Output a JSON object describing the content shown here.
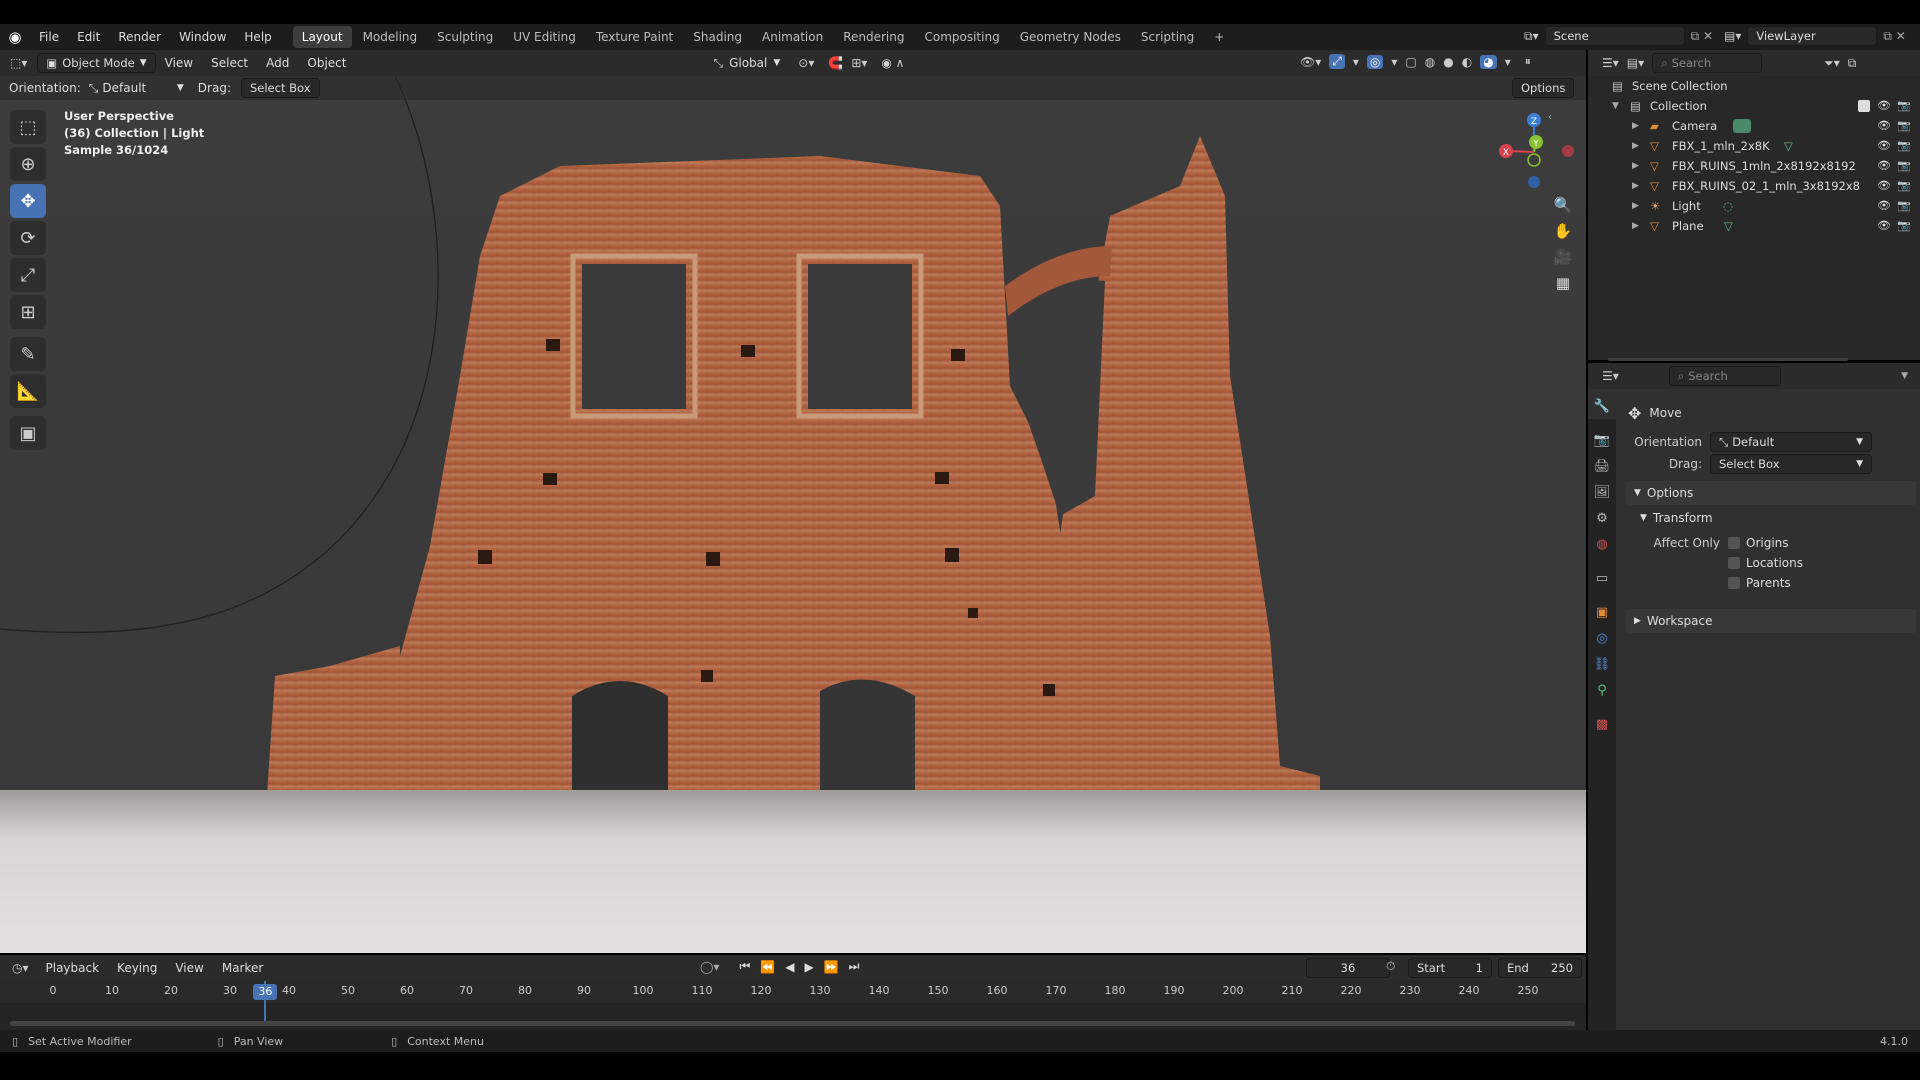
{
  "topbar": {
    "menus": [
      "File",
      "Edit",
      "Render",
      "Window",
      "Help"
    ],
    "workspaces": [
      "Layout",
      "Modeling",
      "Sculpting",
      "UV Editing",
      "Texture Paint",
      "Shading",
      "Animation",
      "Rendering",
      "Compositing",
      "Geometry Nodes",
      "Scripting"
    ],
    "add_tab": "+",
    "scene": "Scene",
    "view_layer": "ViewLayer"
  },
  "viewport_header": {
    "mode": "Object Mode",
    "menus": [
      "View",
      "Select",
      "Add",
      "Object"
    ],
    "transform_orientation": "Global"
  },
  "tool_header": {
    "orientation_label": "Orientation:",
    "orientation_value": "Default",
    "drag_label": "Drag:",
    "drag_value": "Select Box",
    "options": "Options"
  },
  "viewport": {
    "overlay_lines": [
      "User Perspective",
      "(36) Collection | Light",
      "Sample 36/1024"
    ],
    "gizmo": {
      "z": "Z",
      "y": "Y",
      "x": "X"
    }
  },
  "outliner": {
    "search_placeholder": "Search",
    "scene_collection": "Scene Collection",
    "collection": "Collection",
    "items": [
      {
        "name": "Camera",
        "icon": "camera-icon",
        "color": "#c07840"
      },
      {
        "name": "FBX_1_mln_2x8K",
        "icon": "mesh-icon",
        "color": "#e08a3c"
      },
      {
        "name": "FBX_RUINS_1mln_2x8192x8192",
        "icon": "mesh-icon",
        "color": "#e08a3c"
      },
      {
        "name": "FBX_RUINS_02_1_mln_3x8192x8",
        "icon": "mesh-icon",
        "color": "#e08a3c"
      },
      {
        "name": "Light",
        "icon": "light-icon",
        "color": "#c07840"
      },
      {
        "name": "Plane",
        "icon": "mesh-icon",
        "color": "#e08a3c"
      }
    ]
  },
  "properties": {
    "search_placeholder": "Search",
    "tool_name": "Move",
    "orientation_label": "Orientation",
    "orientation_value": "Default",
    "drag_label": "Drag:",
    "drag_value": "Select Box",
    "options_panel": "Options",
    "transform_panel": "Transform",
    "affect_only_label": "Affect Only",
    "affect_options": [
      "Origins",
      "Locations",
      "Parents"
    ],
    "workspace_panel": "Workspace"
  },
  "timeline": {
    "menus": [
      "Playback",
      "Keying",
      "View",
      "Marker"
    ],
    "current_frame": "36",
    "start_label": "Start",
    "start_value": "1",
    "end_label": "End",
    "end_value": "250",
    "ruler": [
      "0",
      "10",
      "20",
      "30",
      "40",
      "50",
      "60",
      "70",
      "80",
      "90",
      "100",
      "110",
      "120",
      "130",
      "140",
      "150",
      "160",
      "170",
      "180",
      "190",
      "200",
      "210",
      "220",
      "230",
      "240",
      "250"
    ]
  },
  "statusbar": {
    "left": "Set Active Modifier",
    "middle": "Pan View",
    "right": "Context Menu",
    "version": "4.1.0"
  },
  "colors": {
    "accent": "#4772b3",
    "x_axis": "#d9424f",
    "y_axis": "#89c232",
    "z_axis": "#3d7fd1",
    "brick": "#b8643f"
  }
}
